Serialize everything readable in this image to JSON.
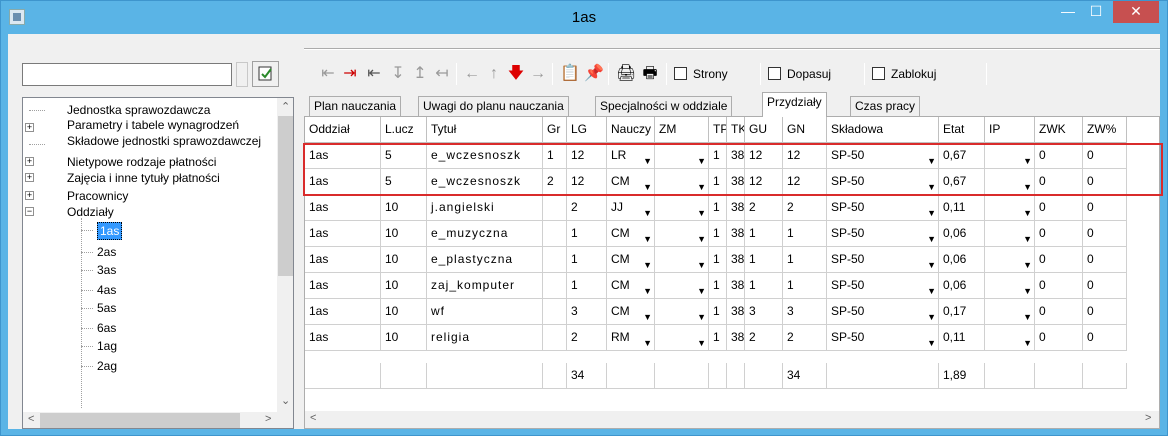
{
  "window": {
    "title": "1as"
  },
  "tree": {
    "items": [
      {
        "label": "Jednostka sprawozdawcza",
        "expand": ""
      },
      {
        "label": "Parametry i tabele wynagrodzeń",
        "expand": "+"
      },
      {
        "label": "Składowe jednostki sprawozdawczej",
        "expand": ""
      },
      {
        "label": "Nietypowe rodzaje płatności",
        "expand": "+"
      },
      {
        "label": "Zajęcia i inne tytuły płatności",
        "expand": "+"
      },
      {
        "label": "Pracownicy",
        "expand": "+"
      },
      {
        "label": "Oddziały",
        "expand": "−"
      }
    ],
    "children": [
      "1as",
      "2as",
      "3as",
      "4as",
      "5as",
      "6as",
      "1ag",
      "2ag"
    ]
  },
  "toolbar": {
    "checkboxes": [
      {
        "label": "Strony"
      },
      {
        "label": "Dopasuj"
      },
      {
        "label": "Zablokuj"
      }
    ]
  },
  "tabs": [
    {
      "label": "Plan nauczania"
    },
    {
      "label": "Uwagi do planu nauczania"
    },
    {
      "label": "Specjalności w oddziale"
    },
    {
      "label": "Przydziały"
    },
    {
      "label": "Czas pracy"
    }
  ],
  "grid": {
    "headers": [
      "Oddział",
      "L.ucz",
      "Tytuł",
      "Gr",
      "LG",
      "Nauczy",
      "ZM",
      "TP",
      "TK",
      "GU",
      "GN",
      "Składowa",
      "Etat",
      "IP",
      "ZWK",
      "ZW%"
    ],
    "rows": [
      [
        "1as",
        "5",
        "e_wczesnoszk",
        "1",
        "12",
        "LR",
        "",
        "1",
        "38",
        "12",
        "12",
        "SP-50",
        "0,67",
        "",
        "0",
        "0"
      ],
      [
        "1as",
        "5",
        "e_wczesnoszk",
        "2",
        "12",
        "CM",
        "",
        "1",
        "38",
        "12",
        "12",
        "SP-50",
        "0,67",
        "",
        "0",
        "0"
      ],
      [
        "1as",
        "10",
        "j.angielski",
        "",
        "2",
        "JJ",
        "",
        "1",
        "38",
        "2",
        "2",
        "SP-50",
        "0,11",
        "",
        "0",
        "0"
      ],
      [
        "1as",
        "10",
        "e_muzyczna",
        "",
        "1",
        "CM",
        "",
        "1",
        "38",
        "1",
        "1",
        "SP-50",
        "0,06",
        "",
        "0",
        "0"
      ],
      [
        "1as",
        "10",
        "e_plastyczna",
        "",
        "1",
        "CM",
        "",
        "1",
        "38",
        "1",
        "1",
        "SP-50",
        "0,06",
        "",
        "0",
        "0"
      ],
      [
        "1as",
        "10",
        "zaj_komputer",
        "",
        "1",
        "CM",
        "",
        "1",
        "38",
        "1",
        "1",
        "SP-50",
        "0,06",
        "",
        "0",
        "0"
      ],
      [
        "1as",
        "10",
        "wf",
        "",
        "3",
        "CM",
        "",
        "1",
        "38",
        "3",
        "3",
        "SP-50",
        "0,17",
        "",
        "0",
        "0"
      ],
      [
        "1as",
        "10",
        "religia",
        "",
        "2",
        "RM",
        "",
        "1",
        "38",
        "2",
        "2",
        "SP-50",
        "0,11",
        "",
        "0",
        "0"
      ]
    ],
    "totals": {
      "lg": "34",
      "gn": "34",
      "etat": "1,89"
    }
  }
}
